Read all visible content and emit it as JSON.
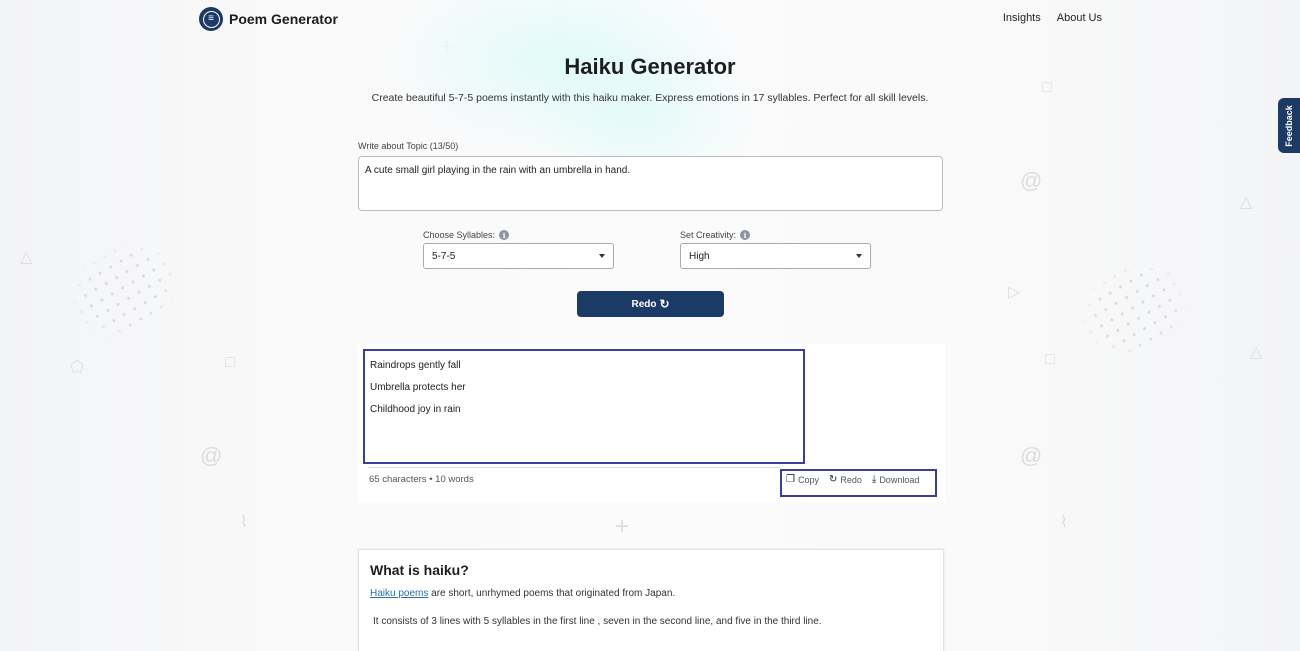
{
  "header": {
    "brand": "Poem Generator",
    "logo_icon": "poem-logo-icon",
    "nav": [
      {
        "label": "Insights"
      },
      {
        "label": "About Us"
      }
    ]
  },
  "feedback_tab": "Feedback",
  "main": {
    "title": "Haiku Generator",
    "subtitle": "Create beautiful 5-7-5 poems instantly with this haiku maker. Express emotions in 17 syllables. Perfect for all skill levels.",
    "topic": {
      "label": "Write about Topic (13/50)",
      "value": "A cute small girl playing in the rain with an umbrella in hand."
    },
    "syllables": {
      "label": "Choose Syllables:",
      "selected": "5-7-5"
    },
    "creativity": {
      "label": "Set Creativity:",
      "selected": "High"
    },
    "redo_button": "Redo",
    "redo_icon": "↻",
    "result": {
      "lines": [
        "Raindrops gently fall",
        "Umbrella protects her",
        "Childhood joy in rain"
      ],
      "stats": "65 characters • 10 words",
      "actions": [
        {
          "label": "Copy",
          "icon": "❐"
        },
        {
          "label": "Redo",
          "icon": "↻"
        },
        {
          "label": "Download",
          "icon": "⤓"
        }
      ]
    },
    "info": {
      "heading": "What is haiku?",
      "link_text": "Haiku poems",
      "p1_rest": " are short, unrhymed poems that originated from Japan.",
      "p2": "It consists of 3 lines with 5 syllables in the first line , seven in the second line, and five in the third line."
    }
  },
  "colors": {
    "brand_navy": "#1b3a66",
    "highlight_border": "#3b3f9a",
    "link": "#2a6fb5"
  }
}
